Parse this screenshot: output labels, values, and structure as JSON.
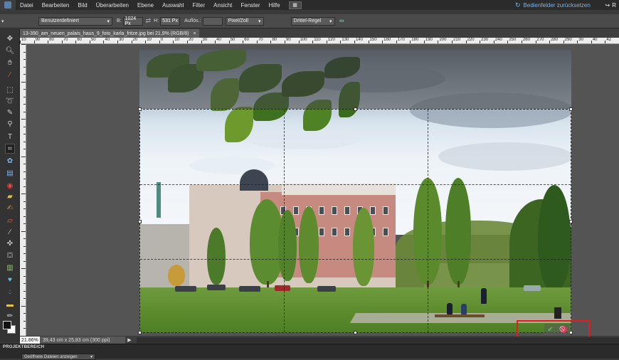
{
  "menubar": {
    "items": [
      "Datei",
      "Bearbeiten",
      "Bild",
      "Überarbeiten",
      "Ebene",
      "Auswahl",
      "Filter",
      "Ansicht",
      "Fenster",
      "Hilfe"
    ],
    "reset_panels": "Bedienfelder zurücksetzen",
    "right_cut_label": "R"
  },
  "options": {
    "preset": "Benutzerdefiniert",
    "width_label": "B:",
    "width_value": "1024 Px",
    "height_label": "H:",
    "height_value": "531 Px",
    "resolution_label": "Auflös.:",
    "resolution_value": "",
    "unit": "Pixel/Zoll",
    "overlay": "Drittel-Regel"
  },
  "tab": {
    "filename": "13-390_am_neuen_palais_haus_9_foto_karla_fritze.jpg bei 21,9% (RGB/8)",
    "close": "×"
  },
  "ruler": {
    "top_ticks": [
      "10",
      "90",
      "80",
      "70",
      "60",
      "50",
      "40",
      "30",
      "20",
      "10",
      "0",
      "10",
      "20",
      "30",
      "40",
      "50",
      "60",
      "70",
      "80",
      "90",
      "100",
      "110",
      "120",
      "130",
      "140",
      "150",
      "160",
      "170",
      "180",
      "190",
      "200",
      "210",
      "220",
      "230",
      "240",
      "250",
      "260",
      "270",
      "280",
      "290",
      "30",
      "40",
      "42"
    ]
  },
  "status": {
    "zoom": "21.86%",
    "doc_size": "39,43 cm x 25,83 cm (300 ppi)",
    "arrow": "▶"
  },
  "project_bin": {
    "title": "PROJEKTBEREICH",
    "select": "Geöffnete Dateien anzeigen"
  },
  "colors": {
    "accent": "#7fb3e6",
    "highlight": "#e21d1d",
    "commit": "#4fc04f",
    "cancel": "#d43c5a"
  },
  "icons": {
    "tools": [
      "move-icon",
      "zoom-icon",
      "hand-icon",
      "eyedropper-icon",
      "marquee-icon",
      "lasso-icon",
      "quick-selection-icon",
      "magic-wand-icon",
      "text-icon",
      "crop-icon",
      "cookie-cutter-icon",
      "straighten-icon",
      "red-eye-icon",
      "spot-healing-icon",
      "smart-brush-icon",
      "clone-stamp-icon",
      "eraser-icon",
      "brush-icon",
      "paint-bucket-icon",
      "gradient-icon",
      "shape-icon",
      "blur-icon",
      "sponge-icon",
      "pencil-icon"
    ]
  }
}
